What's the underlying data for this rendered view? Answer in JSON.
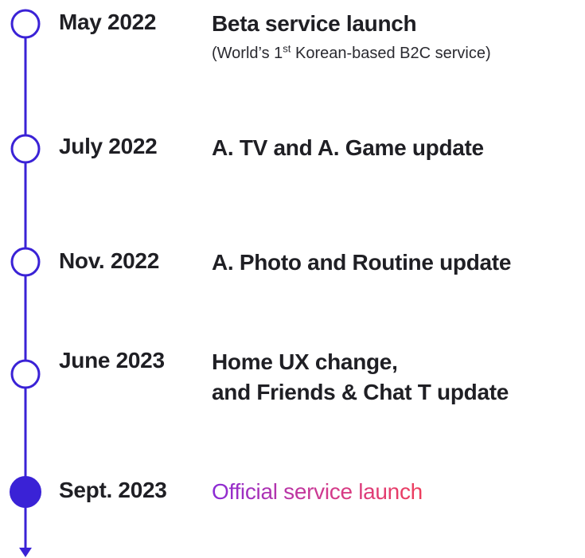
{
  "colors": {
    "line": "#3a22d6",
    "highlight_start": "#8a2bd6",
    "highlight_end": "#ee3e5c",
    "text": "#1f1f24"
  },
  "milestones": [
    {
      "date": "May 2022",
      "title": "Beta service launch",
      "note_prefix": "(World’s 1",
      "note_sup": "st",
      "note_suffix": " Korean-based B2C service)",
      "marker": "hollow"
    },
    {
      "date": "July 2022",
      "title": "A. TV and A. Game update",
      "marker": "hollow"
    },
    {
      "date": "Nov. 2022",
      "title": "A. Photo and Routine update",
      "marker": "hollow"
    },
    {
      "date": "June 2023",
      "title_line1": "Home UX change,",
      "title_line2": "and Friends & Chat T update",
      "marker": "hollow"
    },
    {
      "date": "Sept. 2023",
      "title": "Official service launch",
      "marker": "filled"
    }
  ]
}
